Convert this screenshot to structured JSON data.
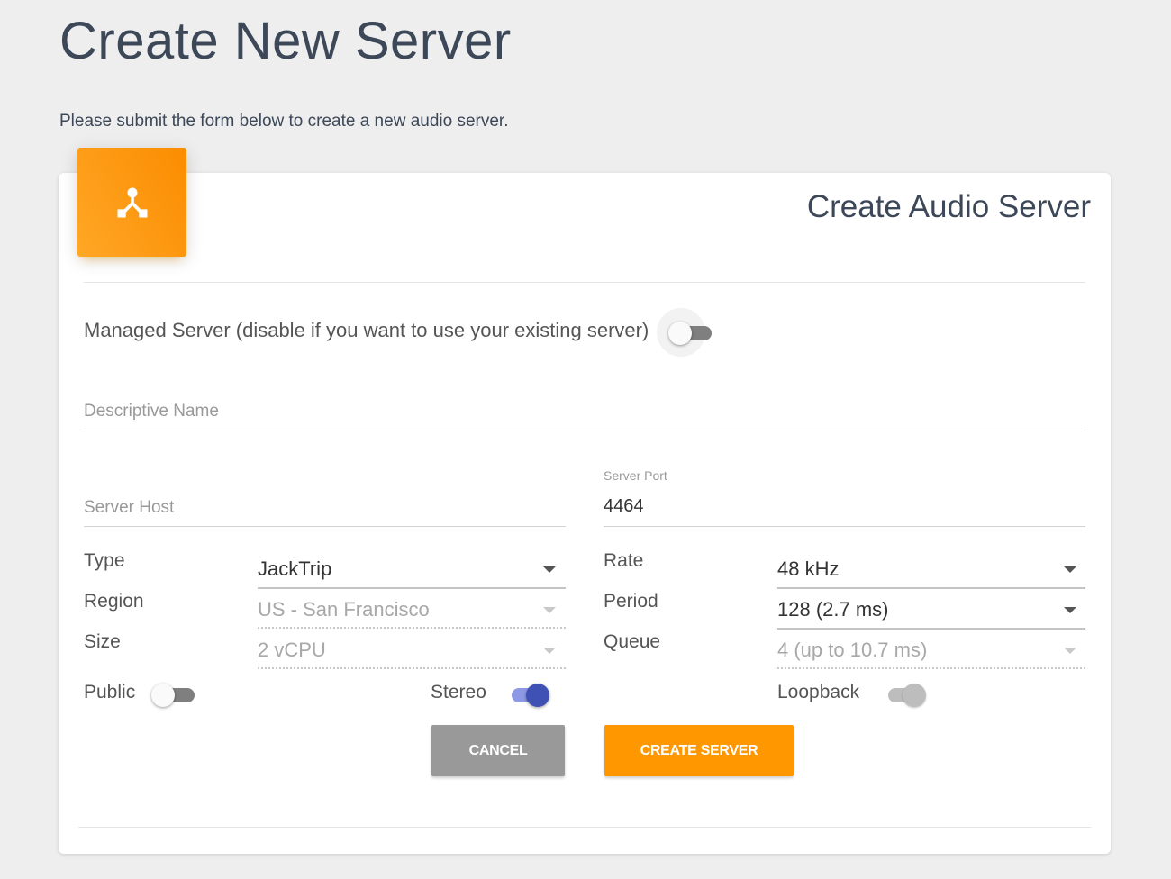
{
  "page": {
    "title": "Create New Server",
    "subtitle": "Please submit the form below to create a new audio server."
  },
  "card": {
    "icon": "device-hub-icon",
    "title": "Create Audio Server",
    "accent_color": "#ff9800"
  },
  "form": {
    "managed_server": {
      "label": "Managed Server (disable if you want to use your existing server)",
      "checked": false
    },
    "descriptive_name": {
      "placeholder": "Descriptive Name",
      "value": ""
    },
    "server_host": {
      "placeholder": "Server Host",
      "value": ""
    },
    "server_port": {
      "label": "Server Port",
      "value": "4464"
    },
    "type": {
      "label": "Type",
      "value": "JackTrip"
    },
    "region": {
      "label": "Region",
      "value": "US - San Francisco",
      "disabled": true
    },
    "size": {
      "label": "Size",
      "value": "2 vCPU",
      "disabled": true
    },
    "rate": {
      "label": "Rate",
      "value": "48 kHz"
    },
    "period": {
      "label": "Period",
      "value": "128 (2.7 ms)"
    },
    "queue": {
      "label": "Queue",
      "value": "4 (up to 10.7 ms)",
      "disabled": true
    },
    "public": {
      "label": "Public",
      "checked": false
    },
    "stereo": {
      "label": "Stereo",
      "checked": true
    },
    "loopback": {
      "label": "Loopback",
      "checked": true,
      "disabled": true
    }
  },
  "buttons": {
    "cancel": "CANCEL",
    "create": "CREATE SERVER"
  }
}
